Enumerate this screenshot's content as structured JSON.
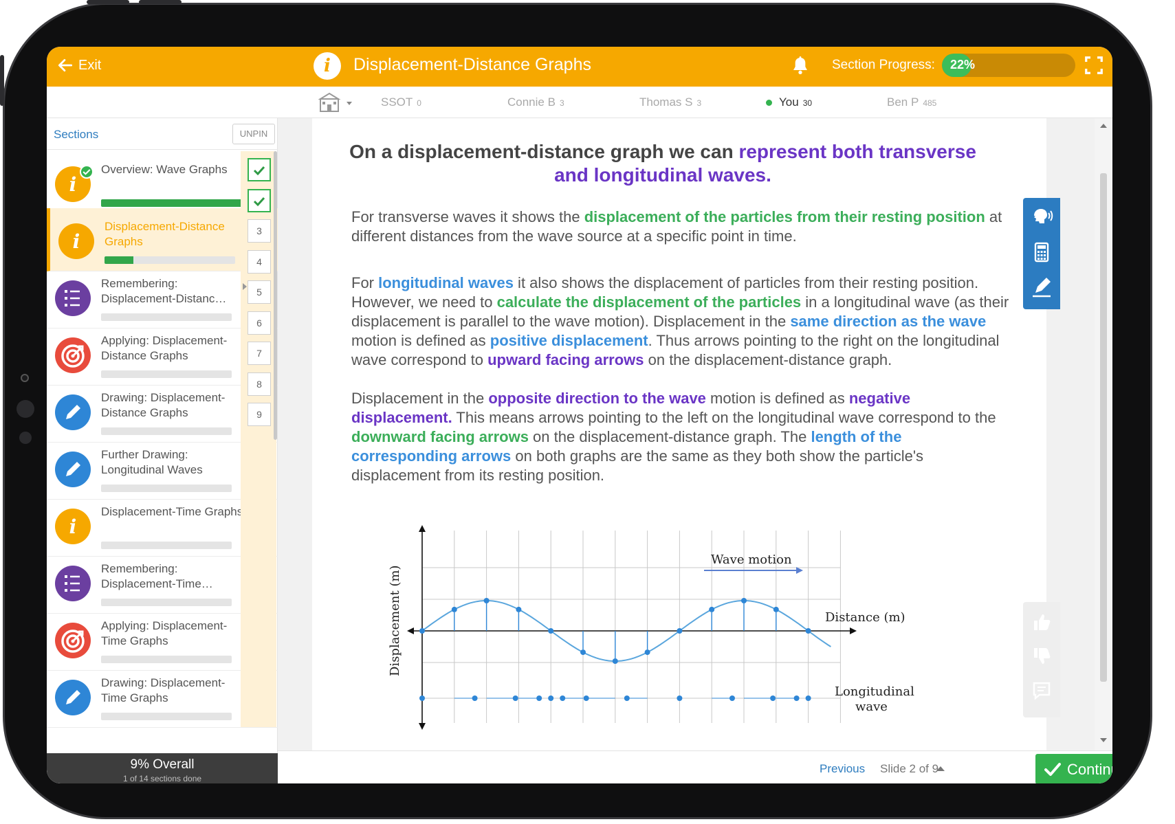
{
  "topbar": {
    "exit_label": "Exit",
    "title": "Displacement-Distance Graphs",
    "progress_label": "Section Progress:",
    "progress_value": "22%",
    "progress_fraction": 0.22
  },
  "leaderboard": [
    {
      "name": "SSOT",
      "score": "0"
    },
    {
      "name": "Connie B",
      "score": "3"
    },
    {
      "name": "Thomas S",
      "score": "3"
    },
    {
      "name": "You",
      "score": "30"
    },
    {
      "name": "Ben P",
      "score": "485"
    }
  ],
  "sidebar": {
    "header": "Sections",
    "unpin_label": "UNPIN",
    "sections": [
      {
        "title": "Overview: Wave Graphs",
        "icon": "info-icon",
        "progress": 1.0
      },
      {
        "title": "Displacement-Distance Graphs",
        "icon": "info-icon",
        "progress": 0.22
      },
      {
        "title": "Remembering: Displacement-Distanc…",
        "icon": "checklist-icon",
        "progress": 0
      },
      {
        "title": "Applying: Displacement-Distance Graphs",
        "icon": "target-icon",
        "progress": 0
      },
      {
        "title": "Drawing: Displacement-Distance Graphs",
        "icon": "pencil-icon",
        "progress": 0
      },
      {
        "title": "Further Drawing: Longitudinal Waves",
        "icon": "pencil-icon",
        "progress": 0
      },
      {
        "title": "Displacement-Time Graphs",
        "icon": "info-icon",
        "progress": 0
      },
      {
        "title": "Remembering: Displacement-Time…",
        "icon": "checklist-icon",
        "progress": 0
      },
      {
        "title": "Applying: Displacement-Time Graphs",
        "icon": "target-icon",
        "progress": 0
      },
      {
        "title": "Drawing: Displacement-Time Graphs",
        "icon": "pencil-icon",
        "progress": 0
      }
    ],
    "slides": [
      "1",
      "2",
      "3",
      "4",
      "5",
      "6",
      "7",
      "8",
      "9"
    ],
    "overall_label": "9% Overall",
    "overall_sub": "1 of 14 sections done"
  },
  "content": {
    "heading_plain": "On a displacement-distance graph we can ",
    "heading_hl": "represent both transverse and longitudinal waves.",
    "p1": [
      {
        "t": "For transverse waves it shows the ",
        "c": ""
      },
      {
        "t": "displacement of the particles from their resting position",
        "c": "g"
      },
      {
        "t": " at different distances from the wave source at a specific point in time.",
        "c": ""
      }
    ],
    "p2": [
      {
        "t": "For ",
        "c": ""
      },
      {
        "t": "longitudinal waves",
        "c": "b"
      },
      {
        "t": " it also shows the displacement of particles from their resting position. However, we need to ",
        "c": ""
      },
      {
        "t": "calculate the displacement of the particles",
        "c": "g"
      },
      {
        "t": " in a longitudinal wave (as their displacement is parallel to the wave motion). Displacement in the ",
        "c": ""
      },
      {
        "t": "same direction as the wave",
        "c": "b"
      },
      {
        "t": " motion is defined as ",
        "c": ""
      },
      {
        "t": "positive displacement",
        "c": "b"
      },
      {
        "t": ". Thus arrows pointing to the right on the longitudinal wave correspond to ",
        "c": ""
      },
      {
        "t": "upward facing arrows",
        "c": "p"
      },
      {
        "t": " on the displacement-distance graph.",
        "c": ""
      }
    ],
    "p3": [
      {
        "t": "Displacement in the ",
        "c": ""
      },
      {
        "t": "opposite direction to the wave",
        "c": "p"
      },
      {
        "t": " motion is defined as ",
        "c": ""
      },
      {
        "t": "negative displacement.",
        "c": "p"
      },
      {
        "t": " This means arrows pointing to the left on the longitudinal wave correspond to the ",
        "c": ""
      },
      {
        "t": "downward facing arrows",
        "c": "g"
      },
      {
        "t": " on the displacement-distance graph. The ",
        "c": ""
      },
      {
        "t": "length of the corresponding arrows",
        "c": "b"
      },
      {
        "t": " on both graphs are the same as they both show the particle's displacement from its resting position.",
        "c": ""
      }
    ]
  },
  "diagram": {
    "ylabel": "Displacement (m)",
    "xlabel": "Distance (m)",
    "wave_motion": "Wave motion",
    "longitudinal_line1": "Longitudinal",
    "longitudinal_line2": "wave",
    "wave_color": "#5aa6dd",
    "particle_color": "#2e86d6",
    "particle_x": [
      0,
      1,
      2,
      3,
      4,
      5,
      6,
      7,
      8,
      9,
      10,
      11,
      12
    ],
    "particle_disp": [
      0,
      0.707,
      1,
      0.707,
      0,
      -0.707,
      -1,
      -0.707,
      0,
      0.707,
      1,
      0.707,
      0
    ]
  },
  "footer": {
    "previous_label": "Previous",
    "slide_label": "Slide 2 of 9",
    "continue_label": "Continue"
  },
  "colors": {
    "brand": "#f6a800",
    "accent_green": "#34b34f",
    "accent_blue": "#2c7cc1",
    "text_purple": "#6a35c5"
  }
}
